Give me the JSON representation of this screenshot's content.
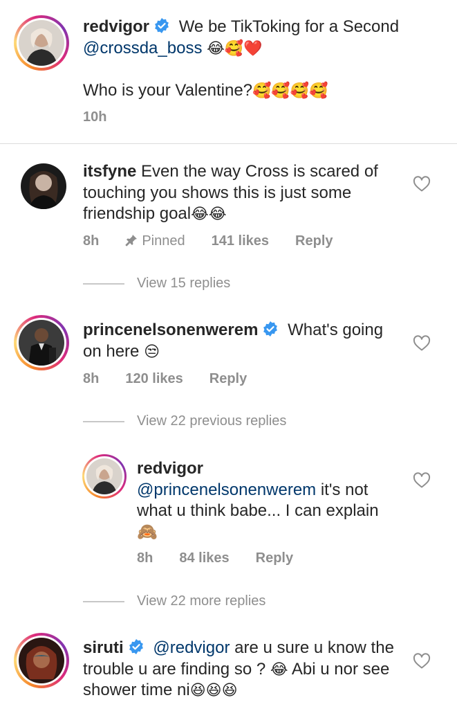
{
  "post": {
    "username": "redvigor",
    "caption_part1": "We be TikToking for a Second",
    "mention": "@crossda_boss",
    "caption_emojis": "😂🥰❤️",
    "caption_line2": "Who is your Valentine?",
    "caption_line2_emojis": "🥰🥰🥰🥰",
    "time": "10h"
  },
  "comments": [
    {
      "username": "itsfyne",
      "text": "Even the way Cross is scared of touching you shows this is just some friendship goal",
      "emojis": "😂😂",
      "time": "8h",
      "pinned_label": "Pinned",
      "likes": "141 likes",
      "reply_label": "Reply",
      "view_replies": "View 15 replies"
    },
    {
      "username": "princenelsonenwerem",
      "text": "What's going on here",
      "emojis": "😒",
      "time": "8h",
      "likes": "120 likes",
      "reply_label": "Reply",
      "view_replies": "View 22 previous replies"
    },
    {
      "username": "redvigor",
      "mention": "@princenelsonenwerem",
      "text": "it's not what u think babe... I can explain",
      "emojis": "🙈",
      "time": "8h",
      "likes": "84 likes",
      "reply_label": "Reply",
      "view_replies": "View 22 more replies"
    },
    {
      "username": "siruti",
      "mention": "@redvigor",
      "text": "are u sure u know the trouble u are finding so ?",
      "emojis_1": "😂",
      "text_2": "Abi u nor see shower time ni",
      "emojis_2": "😆😆😆"
    }
  ],
  "icons": {
    "verified": "verified-badge-icon",
    "like": "heart-outline-icon",
    "pin": "pin-icon"
  },
  "colors": {
    "verified": "#3897f0",
    "mention": "#00376b",
    "meta": "#8e8e8e"
  }
}
